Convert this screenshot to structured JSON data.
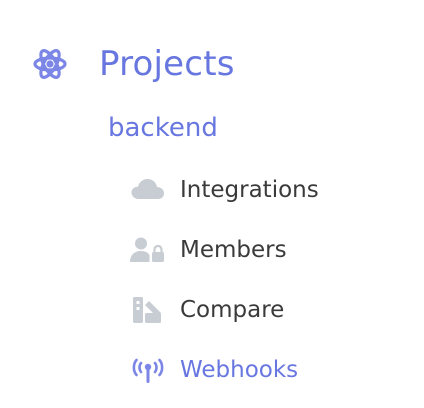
{
  "colors": {
    "accent": "#6877e0",
    "text": "#3a3a3a",
    "icon_gray": "#c7cdd3",
    "icon_accent": "#7b86e6"
  },
  "nav": {
    "project_section": {
      "icon": "atom-icon",
      "label": "Projects"
    },
    "project": {
      "label": "backend"
    },
    "items": [
      {
        "icon": "cloud-icon",
        "label": "Integrations",
        "active": false
      },
      {
        "icon": "members-lock-icon",
        "label": "Members",
        "active": false
      },
      {
        "icon": "compare-icon",
        "label": "Compare",
        "active": false
      },
      {
        "icon": "antenna-icon",
        "label": "Webhooks",
        "active": true
      }
    ]
  }
}
